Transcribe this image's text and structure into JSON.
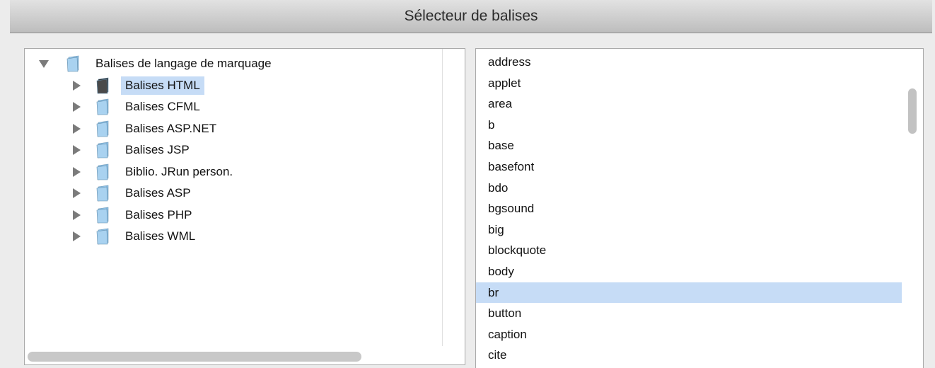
{
  "window": {
    "title": "Sélecteur de balises"
  },
  "tree": {
    "root": {
      "label": "Balises de langage de marquage",
      "expanded": true
    },
    "children": [
      {
        "label": "Balises HTML",
        "selected": true,
        "folder_style": "dark"
      },
      {
        "label": "Balises CFML"
      },
      {
        "label": "Balises ASP.NET"
      },
      {
        "label": "Balises JSP"
      },
      {
        "label": "Biblio. JRun person."
      },
      {
        "label": "Balises ASP"
      },
      {
        "label": "Balises PHP"
      },
      {
        "label": "Balises WML"
      }
    ]
  },
  "tags": {
    "items": [
      "address",
      "applet",
      "area",
      "b",
      "base",
      "basefont",
      "bdo",
      "bgsound",
      "big",
      "blockquote",
      "body",
      "br",
      "button",
      "caption",
      "cite"
    ],
    "selected": "br"
  },
  "colors": {
    "selection": "#c6dcf6",
    "folder": "#a9d2f0",
    "folder_selected": "#4a4a4a"
  }
}
